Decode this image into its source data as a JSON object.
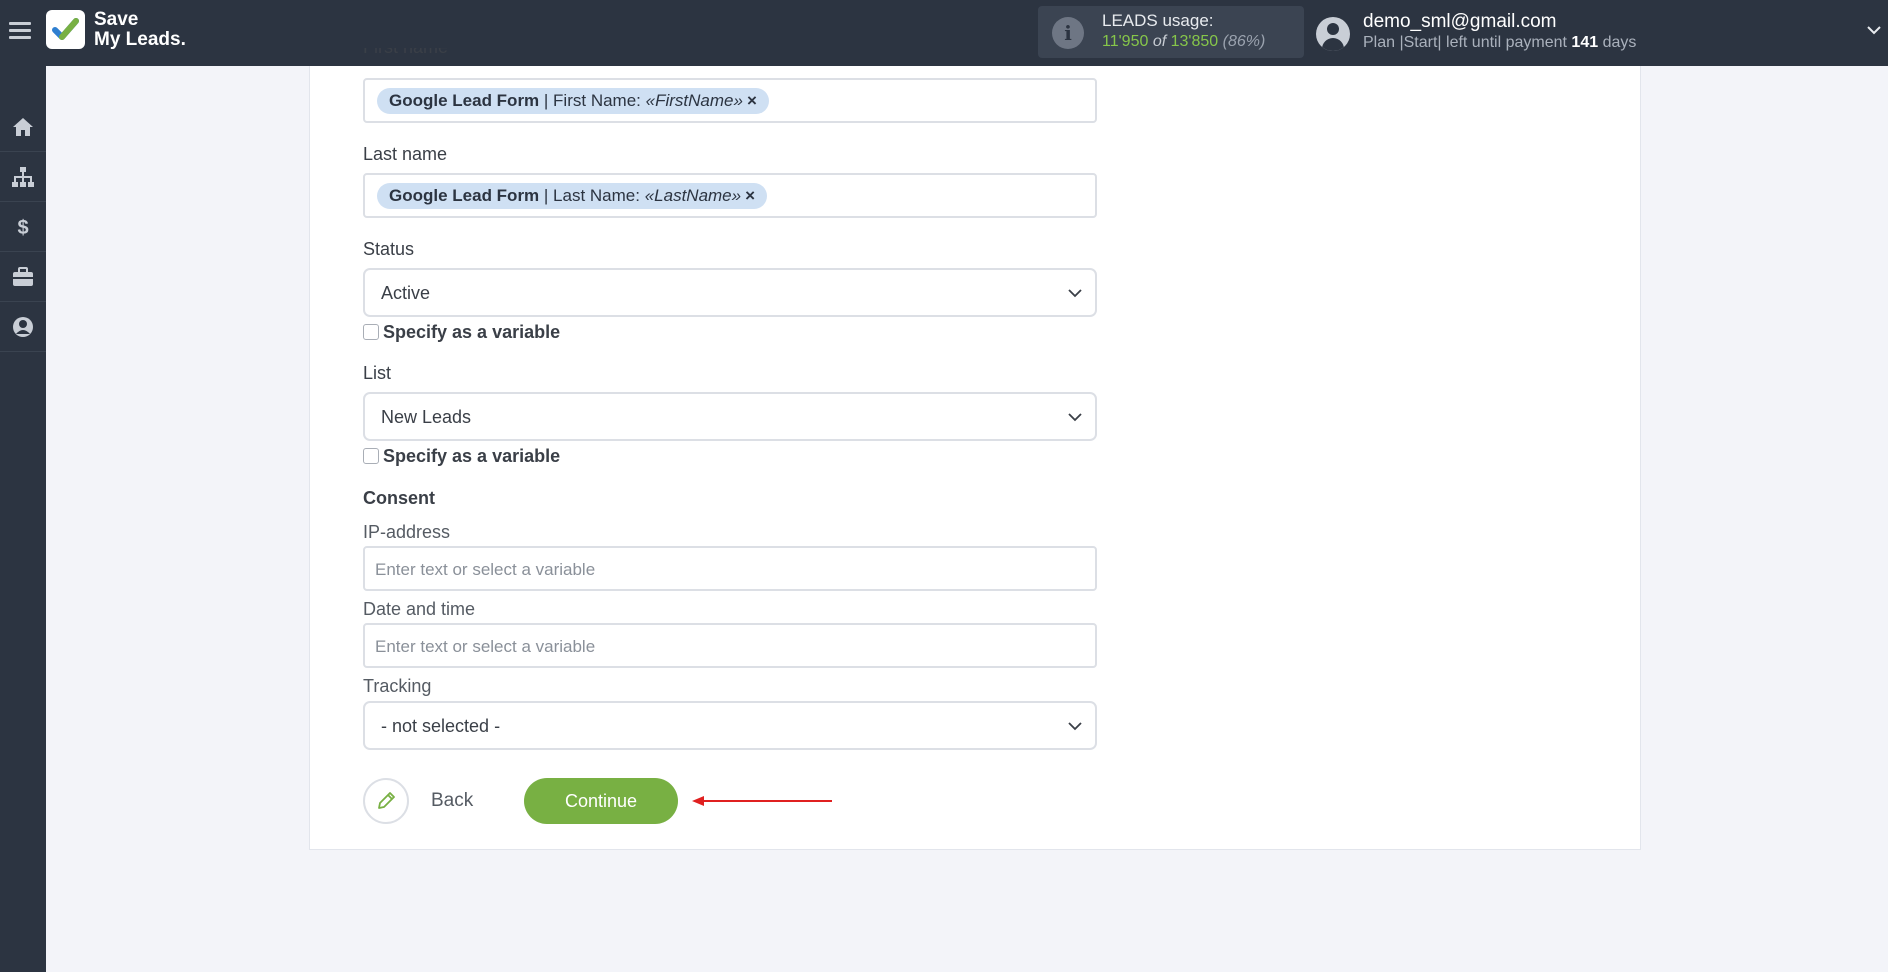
{
  "header": {
    "logo_line1": "Save",
    "logo_line2": "My Leads.",
    "usage_title": "LEADS usage:",
    "usage_used": "11'950",
    "usage_of": "of",
    "usage_total": "13'850",
    "usage_percent": "(86%)",
    "user_email": "demo_sml@gmail.com",
    "plan_prefix": "Plan |Start| left until payment",
    "plan_days": "141",
    "plan_suffix": "days"
  },
  "sidebar": {
    "items": [
      {
        "icon": "home-icon"
      },
      {
        "icon": "sitemap-icon"
      },
      {
        "icon": "dollar-icon"
      },
      {
        "icon": "briefcase-icon"
      },
      {
        "icon": "user-icon"
      }
    ]
  },
  "form": {
    "first_name": {
      "label": "First name",
      "chip_source": "Google Lead Form",
      "chip_field": " | First Name: ",
      "chip_var": "«FirstName»",
      "chip_remove": "×"
    },
    "last_name": {
      "label": "Last name",
      "chip_source": "Google Lead Form",
      "chip_field": " | Last Name: ",
      "chip_var": "«LastName»",
      "chip_remove": "×"
    },
    "status": {
      "label": "Status",
      "value": "Active",
      "checkbox_label": "Specify as a variable"
    },
    "list": {
      "label": "List",
      "value": "New Leads",
      "checkbox_label": "Specify as a variable"
    },
    "consent": {
      "label": "Consent",
      "ip_label": "IP-address",
      "ip_placeholder": "Enter text or select a variable",
      "date_label": "Date and time",
      "date_placeholder": "Enter text or select a variable",
      "tracking_label": "Tracking",
      "tracking_value": "- not selected -"
    },
    "back_label": "Back",
    "continue_label": "Continue"
  },
  "colors": {
    "accent": "#78b043",
    "topbar": "#2c3441",
    "chip": "#cfe0f3",
    "arrow": "#e02020"
  }
}
